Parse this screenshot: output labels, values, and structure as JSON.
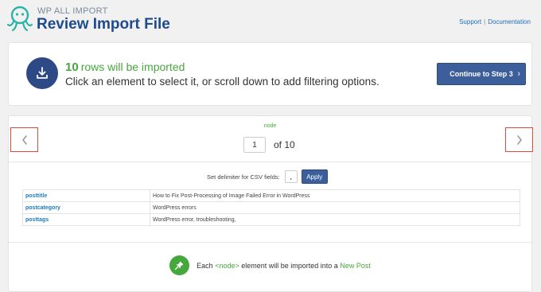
{
  "header": {
    "brand_small": "WP ALL IMPORT",
    "title": "Review Import File",
    "links": {
      "support": "Support",
      "separator": "|",
      "documentation": "Documentation"
    }
  },
  "summary": {
    "rows_count": "10",
    "rows_text": "rows will be imported",
    "hint": "Click an element to select it, or scroll down to add filtering options.",
    "continue_label": "Continue to Step 3"
  },
  "viewer": {
    "node_label": "node",
    "current_page": "1",
    "of_text": "of 10",
    "delimiter_label": "Set delimiter for CSV fields:",
    "delimiter_value": ",",
    "apply_label": "Apply",
    "rows": [
      {
        "key": "posttitle",
        "value": "How to Fix Post-Processing of Image Failed Error in WordPress"
      },
      {
        "key": "postcategory",
        "value": "WordPress errors"
      },
      {
        "key": "posttags",
        "value": "WordPress error, troubleshooting,"
      }
    ]
  },
  "footer": {
    "each": "Each",
    "node": "<node>",
    "middle": "element will be imported into a",
    "target": "New Post"
  },
  "colors": {
    "accent_blue": "#3c5f9b",
    "brand_title": "#1e4b8b",
    "success_green": "#46a73d",
    "nav_highlight": "#e04a3a"
  },
  "icons": [
    "octopus-logo-icon",
    "import-icon",
    "chevron-right-icon",
    "chevron-left-icon",
    "pin-icon"
  ]
}
